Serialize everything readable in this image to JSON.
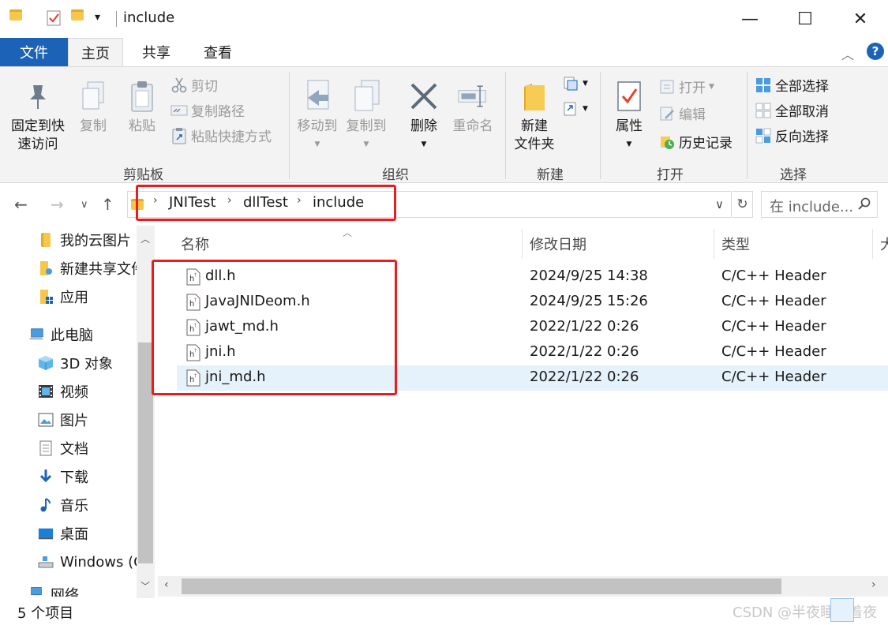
{
  "window": {
    "title": "include",
    "minimize": "—",
    "maximize": "☐",
    "close": "✕"
  },
  "quick_access": {
    "customize": "▾"
  },
  "tabs": [
    {
      "label": "文件"
    },
    {
      "label": "主页"
    },
    {
      "label": "共享"
    },
    {
      "label": "查看"
    }
  ],
  "ribbon": {
    "collapse": "︿",
    "help": "?",
    "clipboard": {
      "group": "剪贴板",
      "pin_line1": "固定到快",
      "pin_line2": "速访问",
      "copy": "复制",
      "paste": "粘贴",
      "cut": "剪切",
      "copy_path": "复制路径",
      "paste_shortcut": "粘贴快捷方式"
    },
    "organize": {
      "group": "组织",
      "move_to": "移动到",
      "copy_to": "复制到",
      "delete": "删除",
      "rename": "重命名"
    },
    "new": {
      "group": "新建",
      "new_folder_line1": "新建",
      "new_folder_line2": "文件夹"
    },
    "open": {
      "group": "打开",
      "properties": "属性",
      "open": "打开",
      "edit": "编辑",
      "history": "历史记录"
    },
    "select": {
      "group": "选择",
      "select_all": "全部选择",
      "select_none": "全部取消",
      "invert": "反向选择"
    }
  },
  "address": {
    "crumbs": [
      "JNITest",
      "dllTest",
      "include"
    ],
    "dropdown": "∨",
    "refresh": "↻"
  },
  "search": {
    "placeholder": "在 include..."
  },
  "navigation": [
    {
      "label": "我的云图片",
      "icon": "folder-icon"
    },
    {
      "label": "新建共享文件",
      "icon": "shared-folder-icon"
    },
    {
      "label": "应用",
      "icon": "apps-folder-icon"
    },
    {
      "label": "此电脑",
      "icon": "computer-icon"
    },
    {
      "label": "3D 对象",
      "icon": "3d-objects-icon"
    },
    {
      "label": "视频",
      "icon": "video-icon"
    },
    {
      "label": "图片",
      "icon": "pictures-icon"
    },
    {
      "label": "文档",
      "icon": "documents-icon"
    },
    {
      "label": "下载",
      "icon": "download-icon"
    },
    {
      "label": "音乐",
      "icon": "music-icon"
    },
    {
      "label": "桌面",
      "icon": "desktop-icon"
    },
    {
      "label": "Windows (C",
      "icon": "drive-icon"
    },
    {
      "label": "网络",
      "icon": "network-icon"
    }
  ],
  "columns": {
    "name": "名称",
    "date": "修改日期",
    "type": "类型",
    "size": "大"
  },
  "files": [
    {
      "name": "dll.h",
      "date": "2024/9/25 14:38",
      "type": "C/C++ Header"
    },
    {
      "name": "JavaJNIDeom.h",
      "date": "2024/9/25 15:26",
      "type": "C/C++ Header"
    },
    {
      "name": "jawt_md.h",
      "date": "2022/1/22 0:26",
      "type": "C/C++ Header"
    },
    {
      "name": "jni.h",
      "date": "2022/1/22 0:26",
      "type": "C/C++ Header"
    },
    {
      "name": "jni_md.h",
      "date": "2022/1/22 0:26",
      "type": "C/C++ Header"
    }
  ],
  "status": {
    "count": "5 个项目",
    "watermark": "CSDN @半夜睡不着夜"
  },
  "colors": {
    "accent": "#1c63b7",
    "highlight": "#ec1c1c",
    "selection": "#e5f1fb"
  }
}
